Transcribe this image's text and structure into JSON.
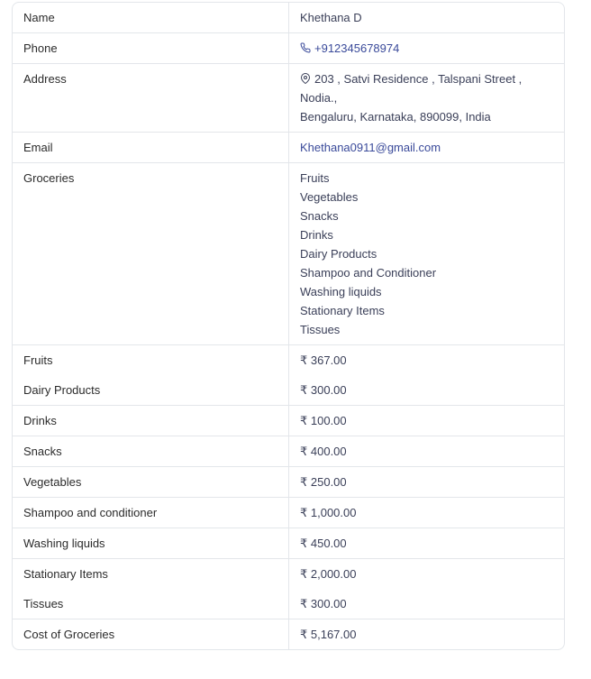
{
  "contact": {
    "name_label": "Name",
    "name_value": "Khethana D",
    "phone_label": "Phone",
    "phone_value": "+912345678974",
    "phone_icon": "phone-icon",
    "address_label": "Address",
    "address_icon": "location-pin-icon",
    "address_line1": "203 , Satvi Residence , Talspani Street , Nodia.,",
    "address_line2": "Bengaluru, Karnataka, 890099, India",
    "email_label": "Email",
    "email_value": "Khethana0911@gmail.com"
  },
  "groceries": {
    "label": "Groceries",
    "items": [
      "Fruits",
      "Vegetables",
      "Snacks",
      "Drinks",
      "Dairy Products",
      "Shampoo and Conditioner",
      "Washing liquids",
      "Stationary Items",
      "Tissues"
    ]
  },
  "prices": [
    {
      "label": "Fruits",
      "value": "₹ 367.00"
    },
    {
      "label": "Dairy Products",
      "value": "₹ 300.00"
    },
    {
      "label": "Drinks",
      "value": "₹ 100.00"
    },
    {
      "label": "Snacks",
      "value": "₹ 400.00"
    },
    {
      "label": "Vegetables",
      "value": "₹ 250.00"
    },
    {
      "label": "Shampoo and conditioner",
      "value": "₹ 1,000.00"
    },
    {
      "label": "Washing liquids",
      "value": "₹ 450.00"
    },
    {
      "label": "Stationary Items",
      "value": "₹ 2,000.00"
    },
    {
      "label": "Tissues",
      "value": "₹ 300.00"
    }
  ],
  "total": {
    "label": "Cost of Groceries",
    "value": "₹ 5,167.00"
  },
  "colors": {
    "border": "#e3e6ea",
    "link": "#3a4a9a",
    "text": "#2b2b2b"
  }
}
